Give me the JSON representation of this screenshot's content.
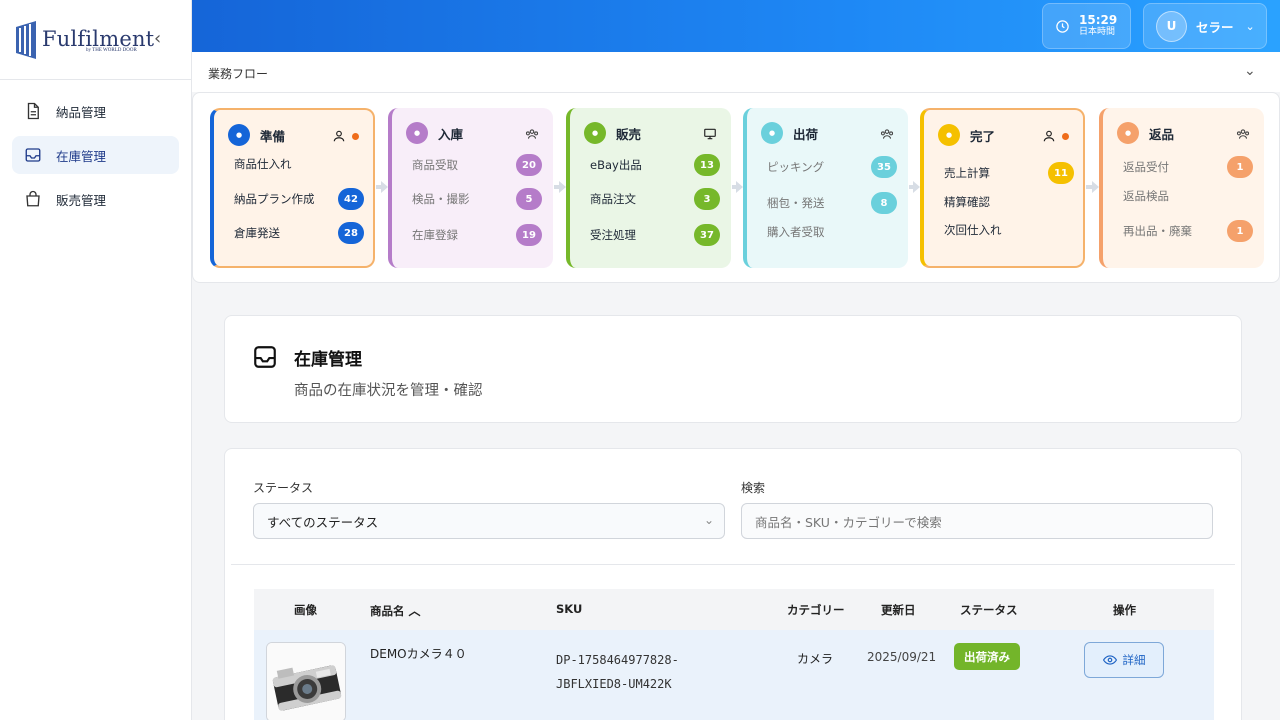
{
  "brand": {
    "title": "Fulfilment",
    "subtitle": "by THE WORLD DOOR"
  },
  "sidebar": {
    "collapse": "‹",
    "items": [
      {
        "label": "納品管理",
        "icon": "document-icon"
      },
      {
        "label": "在庫管理",
        "icon": "inbox-icon",
        "active": true
      },
      {
        "label": "販売管理",
        "icon": "shopping-bag-icon"
      }
    ]
  },
  "topbar": {
    "time": "15:29",
    "timezone": "日本時間",
    "user_initial": "U",
    "user_name": "セラー"
  },
  "workflow": {
    "title": "業務フロー",
    "stages": [
      {
        "name": "準備",
        "color": "#1565d8",
        "bg": "#fff3e8",
        "border": "#f5b26b",
        "alert": true,
        "tasks": [
          {
            "label": "商品仕入れ",
            "count": ""
          },
          {
            "label": "納品プラン作成",
            "count": "42"
          },
          {
            "label": "倉庫発送",
            "count": "28"
          }
        ]
      },
      {
        "name": "入庫",
        "color": "#b57cc9",
        "bg": "#f8eef9",
        "border": "#b57cc9",
        "alert": false,
        "tasks": [
          {
            "label": "商品受取",
            "count": "20"
          },
          {
            "label": "検品・撮影",
            "count": "5"
          },
          {
            "label": "在庫登録",
            "count": "19"
          }
        ]
      },
      {
        "name": "販売",
        "color": "#76b82a",
        "bg": "#eaf6e6",
        "border": "#76b82a",
        "alert": false,
        "tasks": [
          {
            "label": "eBay出品",
            "count": "13"
          },
          {
            "label": "商品注文",
            "count": "3"
          },
          {
            "label": "受注処理",
            "count": "37"
          }
        ]
      },
      {
        "name": "出荷",
        "color": "#6ad0dc",
        "bg": "#e9f8f9",
        "border": "#6ad0dc",
        "alert": false,
        "tasks": [
          {
            "label": "ピッキング",
            "count": "35"
          },
          {
            "label": "梱包・発送",
            "count": "8"
          },
          {
            "label": "購入者受取",
            "count": ""
          }
        ]
      },
      {
        "name": "完了",
        "color": "#f5c000",
        "bg": "#fff3e8",
        "border": "#f5b26b",
        "alert": true,
        "tasks": [
          {
            "label": "売上計算",
            "count": "11"
          },
          {
            "label": "精算確認",
            "count": ""
          },
          {
            "label": "次回仕入れ",
            "count": ""
          }
        ]
      },
      {
        "name": "返品",
        "color": "#f5a16b",
        "bg": "#fff4ea",
        "border": "#f5a16b",
        "alert": false,
        "tasks": [
          {
            "label": "返品受付",
            "count": "1"
          },
          {
            "label": "返品検品",
            "count": ""
          },
          {
            "label": "再出品・廃棄",
            "count": "1"
          }
        ]
      }
    ]
  },
  "page": {
    "title": "在庫管理",
    "subtitle": "商品の在庫状況を管理・確認"
  },
  "filters": {
    "status_label": "ステータス",
    "status_value": "すべてのステータス",
    "search_label": "検索",
    "search_placeholder": "商品名・SKU・カテゴリーで検索"
  },
  "table": {
    "headers": {
      "image": "画像",
      "name": "商品名",
      "sku": "SKU",
      "category": "カテゴリー",
      "updated": "更新日",
      "status": "ステータス",
      "action": "操作"
    },
    "rows": [
      {
        "name": "DEMOカメラ４０",
        "sku_line1": "DP-1758464977828-",
        "sku_line2": "JBFLXIED8-UM422K",
        "category": "カメラ",
        "updated": "2025/09/21",
        "status": "出荷済み",
        "action": "詳細"
      }
    ]
  },
  "colors": {
    "accent": "#1565d8",
    "status_shipped": "#73b52a"
  }
}
